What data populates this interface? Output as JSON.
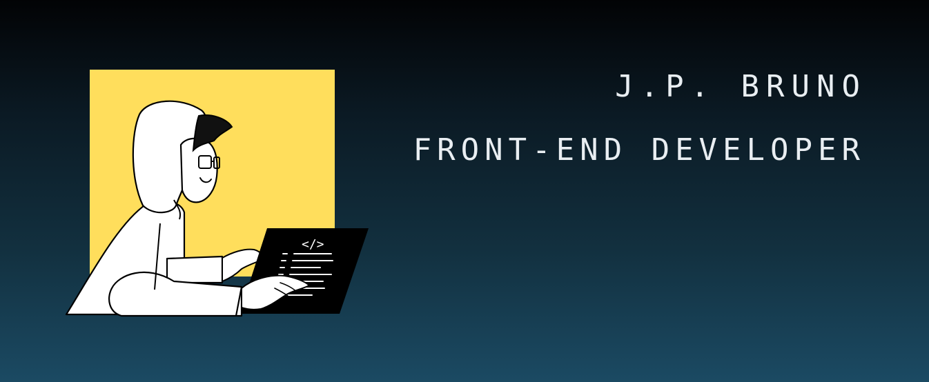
{
  "hero": {
    "name": "J.P. BRUNO",
    "role": "FRONT-END DEVELOPER",
    "illustration": {
      "icon": "developer-coding-illustration",
      "code_symbol": "</>",
      "colors": {
        "panel": "#FFDE5C",
        "outline": "#000000",
        "fill": "#FFFFFF",
        "laptop": "#000000"
      }
    }
  }
}
